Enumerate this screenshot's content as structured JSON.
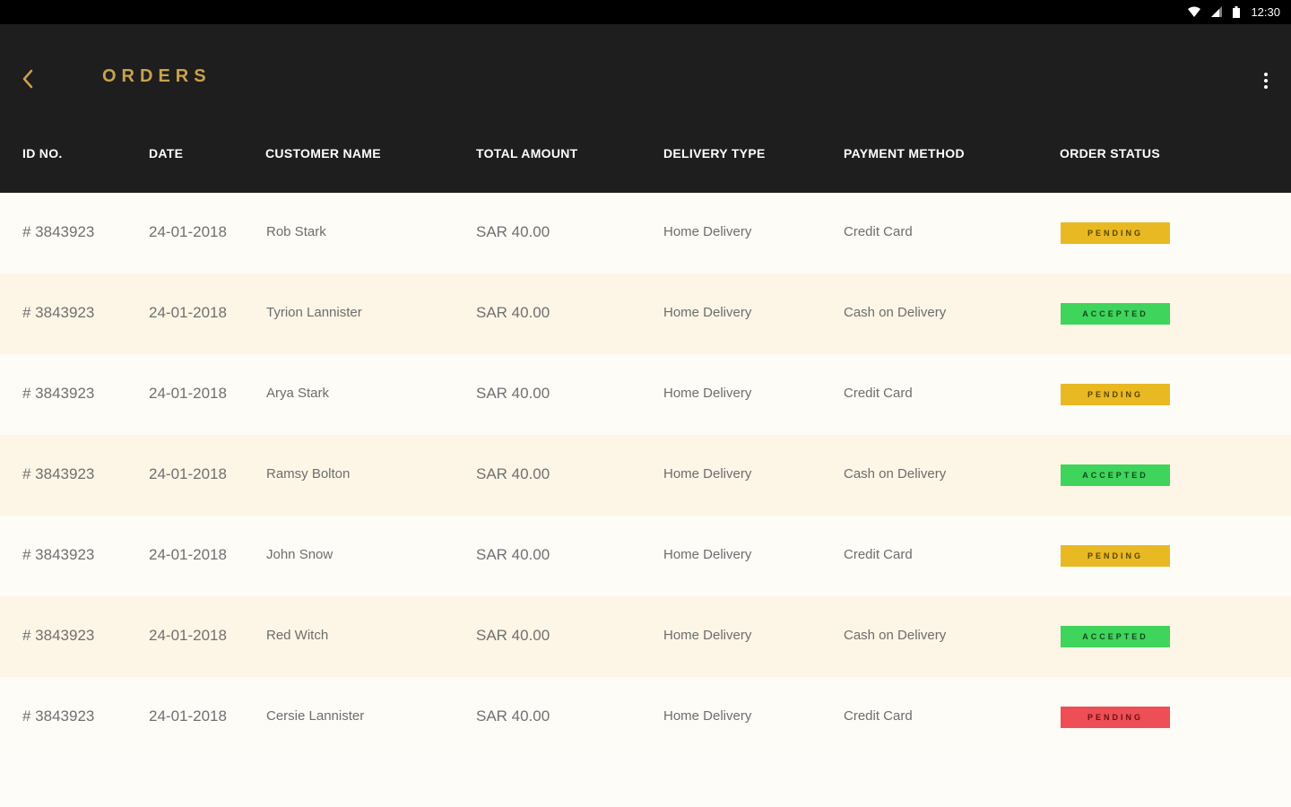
{
  "status_bar": {
    "time": "12:30"
  },
  "app_bar": {
    "title": "ORDERS"
  },
  "colors": {
    "accent": "#c9a24a",
    "pending": "#e8b923",
    "accepted": "#3fd45c",
    "danger": "#ee4e55",
    "header_bg": "#1e1e1e"
  },
  "table": {
    "headers": [
      "ID NO.",
      "DATE",
      "CUSTOMER NAME",
      "TOTAL AMOUNT",
      "DELIVERY TYPE",
      "PAYMENT METHOD",
      "ORDER STATUS"
    ],
    "rows": [
      {
        "id": "# 3843923",
        "date": "24-01-2018",
        "customer": "Rob Stark",
        "amount": "SAR 40.00",
        "delivery": "Home Delivery",
        "payment": "Credit Card",
        "status": "PENDING",
        "status_color": "pending"
      },
      {
        "id": "# 3843923",
        "date": "24-01-2018",
        "customer": "Tyrion Lannister",
        "amount": "SAR 40.00",
        "delivery": "Home Delivery",
        "payment": "Cash on Delivery",
        "status": "ACCEPTED",
        "status_color": "accepted"
      },
      {
        "id": "# 3843923",
        "date": "24-01-2018",
        "customer": "Arya Stark",
        "amount": "SAR 40.00",
        "delivery": "Home Delivery",
        "payment": "Credit Card",
        "status": "PENDING",
        "status_color": "pending"
      },
      {
        "id": "# 3843923",
        "date": "24-01-2018",
        "customer": "Ramsy Bolton",
        "amount": "SAR 40.00",
        "delivery": "Home Delivery",
        "payment": "Cash on Delivery",
        "status": "ACCEPTED",
        "status_color": "accepted"
      },
      {
        "id": "# 3843923",
        "date": "24-01-2018",
        "customer": "John Snow",
        "amount": "SAR 40.00",
        "delivery": "Home Delivery",
        "payment": "Credit Card",
        "status": "PENDING",
        "status_color": "pending"
      },
      {
        "id": "# 3843923",
        "date": "24-01-2018",
        "customer": "Red Witch",
        "amount": "SAR 40.00",
        "delivery": "Home Delivery",
        "payment": "Cash on Delivery",
        "status": "ACCEPTED",
        "status_color": "accepted"
      },
      {
        "id": "# 3843923",
        "date": "24-01-2018",
        "customer": "Cersie Lannister",
        "amount": "SAR 40.00",
        "delivery": "Home Delivery",
        "payment": "Credit Card",
        "status": "PENDING",
        "status_color": "danger"
      }
    ]
  }
}
